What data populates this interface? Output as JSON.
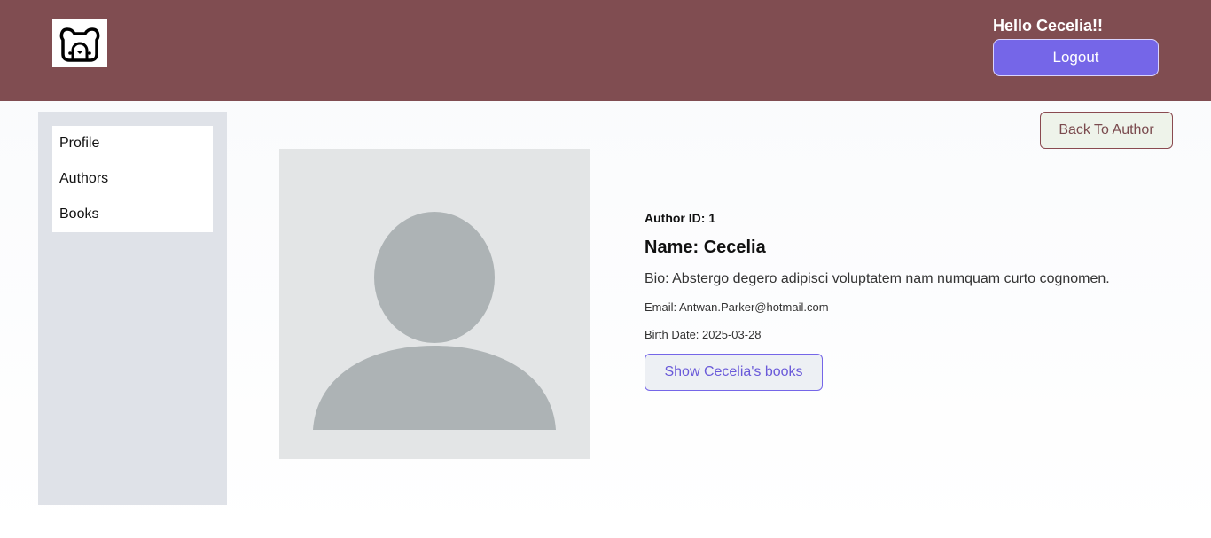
{
  "header": {
    "greeting": "Hello Cecelia!!",
    "logout_label": "Logout",
    "logo_icon": "bear-face-icon",
    "background": "#804d51",
    "accent": "#7566e8"
  },
  "sidebar": {
    "items": [
      {
        "label": "Profile"
      },
      {
        "label": "Authors"
      },
      {
        "label": "Books"
      }
    ]
  },
  "main": {
    "back_label": "Back To Author",
    "avatar_icon": "user-placeholder-icon",
    "author_id": "Author ID: 1",
    "name": "Name: Cecelia",
    "bio": "Bio: Abstergo degero adipisci voluptatem nam numquam curto cognomen.",
    "email": "Email: Antwan.Parker@hotmail.com",
    "birth_date": "Birth Date: 2025-03-28",
    "books_button_label": "Show Cecelia's books"
  }
}
